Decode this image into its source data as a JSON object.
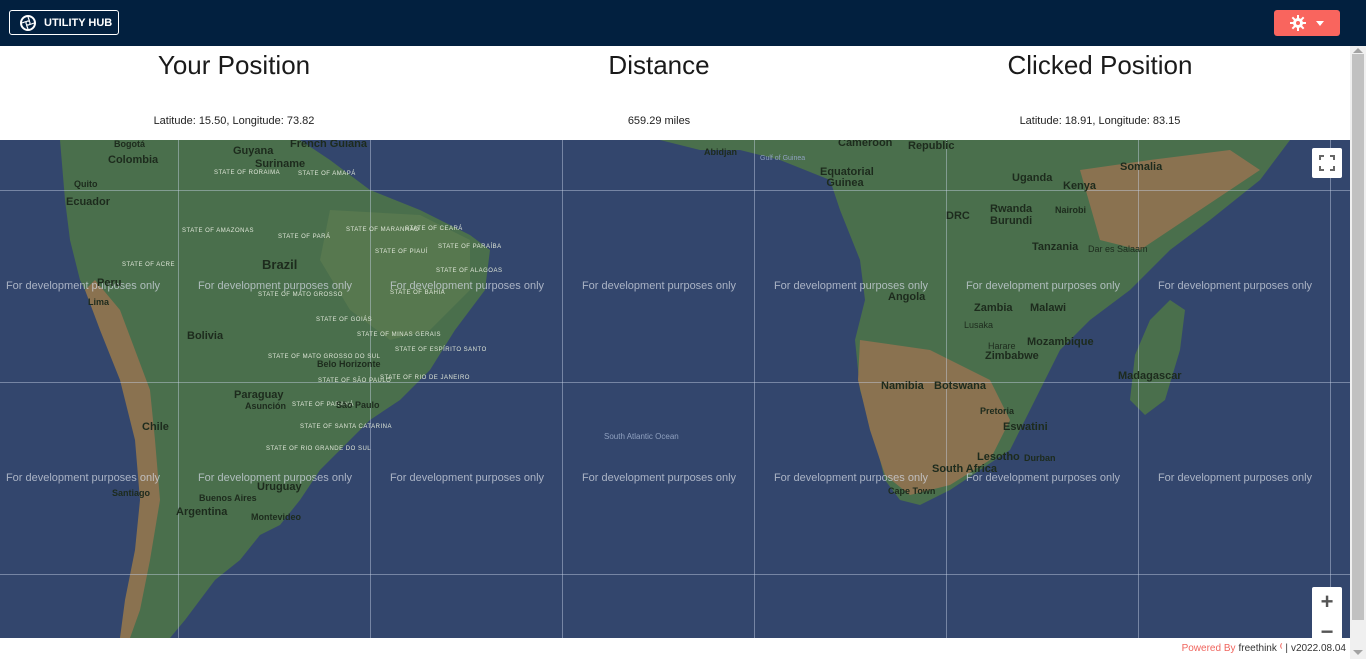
{
  "header": {
    "brand_label": "UTILITY HUB",
    "accent_color": "#f9655e",
    "bar_color": "#02203f",
    "settings_icon": "gear-icon",
    "dropdown_icon": "caret-down-icon"
  },
  "info": {
    "your_position": {
      "title": "Your Position",
      "value": "Latitude: 15.50, Longitude: 73.82"
    },
    "distance": {
      "title": "Distance",
      "value": "659.29 miles"
    },
    "clicked_position": {
      "title": "Clicked Position",
      "value": "Latitude: 18.91, Longitude: 83.15"
    }
  },
  "map": {
    "watermark": "For development purposes only",
    "water_color": "#33466d",
    "land_color": "#496e4d",
    "desert_color": "#8c7352",
    "labels": {
      "bogota": "Bogotá",
      "colombia": "Colombia",
      "guyana": "Guyana",
      "suriname": "Suriname",
      "french_guiana": "French Guiana",
      "quito": "Quito",
      "ecuador": "Ecuador",
      "brazil": "Brazil",
      "peru": "Peru",
      "lima": "Lima",
      "bolivia": "Bolivia",
      "paraguay": "Paraguay",
      "asuncion": "Asunción",
      "belo_horizonte": "Belo Horizonte",
      "sao_paulo": "São Paulo",
      "chile": "Chile",
      "santiago": "Santiago",
      "uruguay": "Uruguay",
      "buenos_aires": "Buenos Aires",
      "montevideo": "Montevideo",
      "argentina": "Argentina",
      "state_roraima": "STATE OF RORAIMA",
      "state_amapa": "STATE OF AMAPÁ",
      "state_amazonas": "STATE OF AMAZONAS",
      "state_para": "STATE OF PARÁ",
      "state_maranhao": "STATE OF MARANHÃO",
      "state_ceara": "STATE OF CEARÁ",
      "state_piaui": "STATE OF PIAUÍ",
      "state_paraiba": "STATE OF PARAÍBA",
      "state_acre": "STATE OF ACRE",
      "state_alagoas": "STATE OF ALAGOAS",
      "state_mato_grosso": "STATE OF MATO GROSSO",
      "state_bahia": "STATE OF BAHIA",
      "state_goias": "STATE OF GOIÁS",
      "state_minas": "STATE OF MINAS GERAIS",
      "state_espirito_santo": "STATE OF ESPÍRITO SANTO",
      "state_ms": "STATE OF MATO GROSSO DO SUL",
      "state_sp": "STATE OF SÃO PAULO",
      "state_rj": "STATE OF RIO DE JANEIRO",
      "state_parana": "STATE OF PARANÁ",
      "state_sc": "STATE OF SANTA CATARINA",
      "state_rs": "STATE OF RIO GRANDE DO SUL",
      "abidjan": "Abidjan",
      "gulf_guinea": "Gulf of Guinea",
      "cameroon": "Cameroon",
      "republic": "Republic",
      "equatorial_guinea": "Equatorial Guinea",
      "somalia": "Somalia",
      "uganda": "Uganda",
      "kenya": "Kenya",
      "nairobi": "Nairobi",
      "drc": "DRC",
      "rwanda": "Rwanda",
      "burundi": "Burundi",
      "tanzania": "Tanzania",
      "dar_es_salaam": "Dar es Salaam",
      "angola": "Angola",
      "zambia": "Zambia",
      "malawi": "Malawi",
      "lusaka": "Lusaka",
      "harare": "Harare",
      "zimbabwe": "Zimbabwe",
      "mozambique": "Mozambique",
      "madagascar": "Madagascar",
      "namibia": "Namibia",
      "botswana": "Botswana",
      "pretoria": "Pretoria",
      "eswatini": "Eswatini",
      "lesotho": "Lesotho",
      "durban": "Durban",
      "south_africa": "South Africa",
      "cape_town": "Cape Town",
      "ocean": "South Atlantic Ocean"
    }
  },
  "controls": {
    "fullscreen_icon": "fullscreen-icon",
    "zoom_in": "+",
    "zoom_out": "−"
  },
  "footer": {
    "powered_by": "Powered By",
    "company": "freethink",
    "separator": "|",
    "version": "v2022.08.04"
  }
}
